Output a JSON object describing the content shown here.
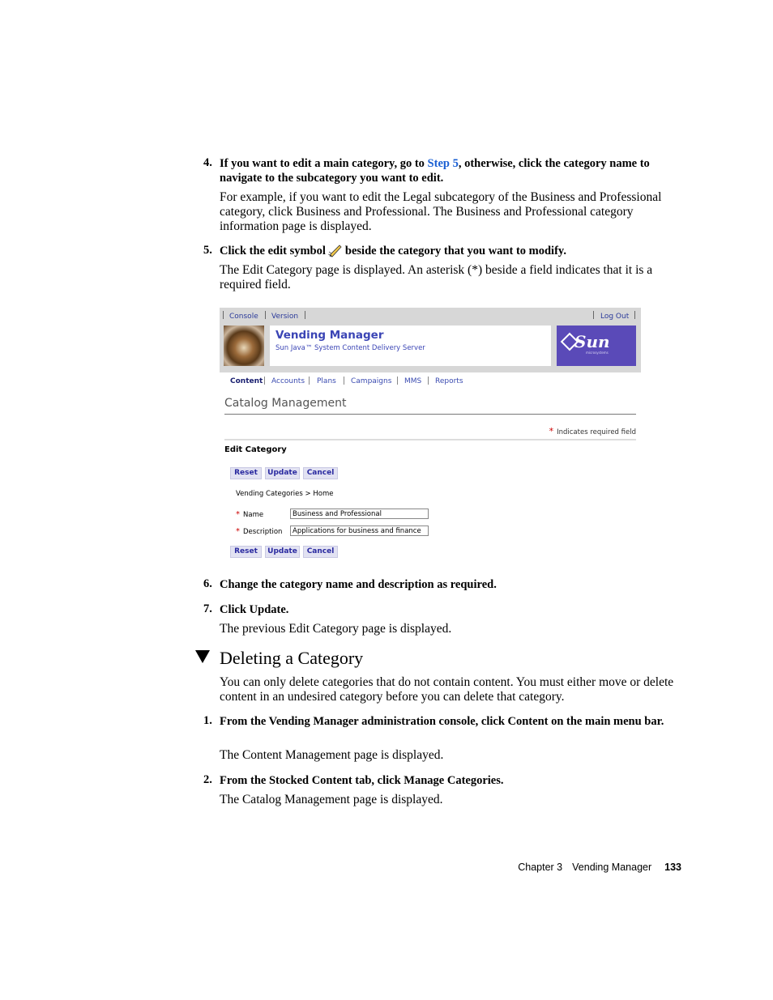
{
  "steps_top": [
    {
      "num": "4.",
      "pre": "If you want to edit a main category, go to ",
      "link": "Step 5",
      "post": ", otherwise, click the category name to navigate to the subcategory you want to edit."
    },
    {
      "num": "5.",
      "pre": "Click the edit symbol",
      "post": "beside the category that you want to modify."
    }
  ],
  "para_4": "For example, if you want to edit the Legal subcategory of the Business and Professional category, click Business and Professional. The Business and Professional category information page is displayed.",
  "para_5": "The Edit Category page is displayed. An asterisk (*) beside a field indicates that it is a required field.",
  "screenshot": {
    "top_links": [
      "Console",
      "Version",
      "Log Out"
    ],
    "app_title": "Vending Manager",
    "app_subtitle": "Sun Java™ System Content Delivery Server",
    "logo_text": "Sun",
    "logo_small": "microsystems",
    "tabs": [
      "Content",
      "Accounts",
      "Plans",
      "Campaigns",
      "MMS",
      "Reports"
    ],
    "page_title": "Catalog Management",
    "required_note": "Indicates required field",
    "asterisk": "*",
    "section_title": "Edit Category",
    "buttons": [
      "Reset",
      "Update",
      "Cancel"
    ],
    "breadcrumb": "Vending Categories  >  Home",
    "fields": [
      {
        "label": "Name",
        "value": "Business and Professional"
      },
      {
        "label": "Description",
        "value": "Applications for business and finance"
      }
    ]
  },
  "steps_mid": [
    {
      "num": "6.",
      "text": "Change the category name and description as required."
    },
    {
      "num": "7.",
      "text": "Click Update."
    }
  ],
  "para_7": "The previous Edit Category page is displayed.",
  "section_heading": "Deleting a Category",
  "section_intro": "You can only delete categories that do not contain content. You must either move or delete content in an undesired category before you can delete that category.",
  "steps_bottom": [
    {
      "num": "1.",
      "text": "From the Vending Manager administration console, click Content on the main menu bar."
    },
    {
      "num": "2.",
      "text": "From the Stocked Content tab, click Manage Categories."
    }
  ],
  "para_b1": "The Content Management page is displayed.",
  "para_b2": "The Catalog Management page is displayed.",
  "footer": {
    "chapter": "Chapter 3",
    "title": "Vending Manager",
    "page": "133"
  }
}
